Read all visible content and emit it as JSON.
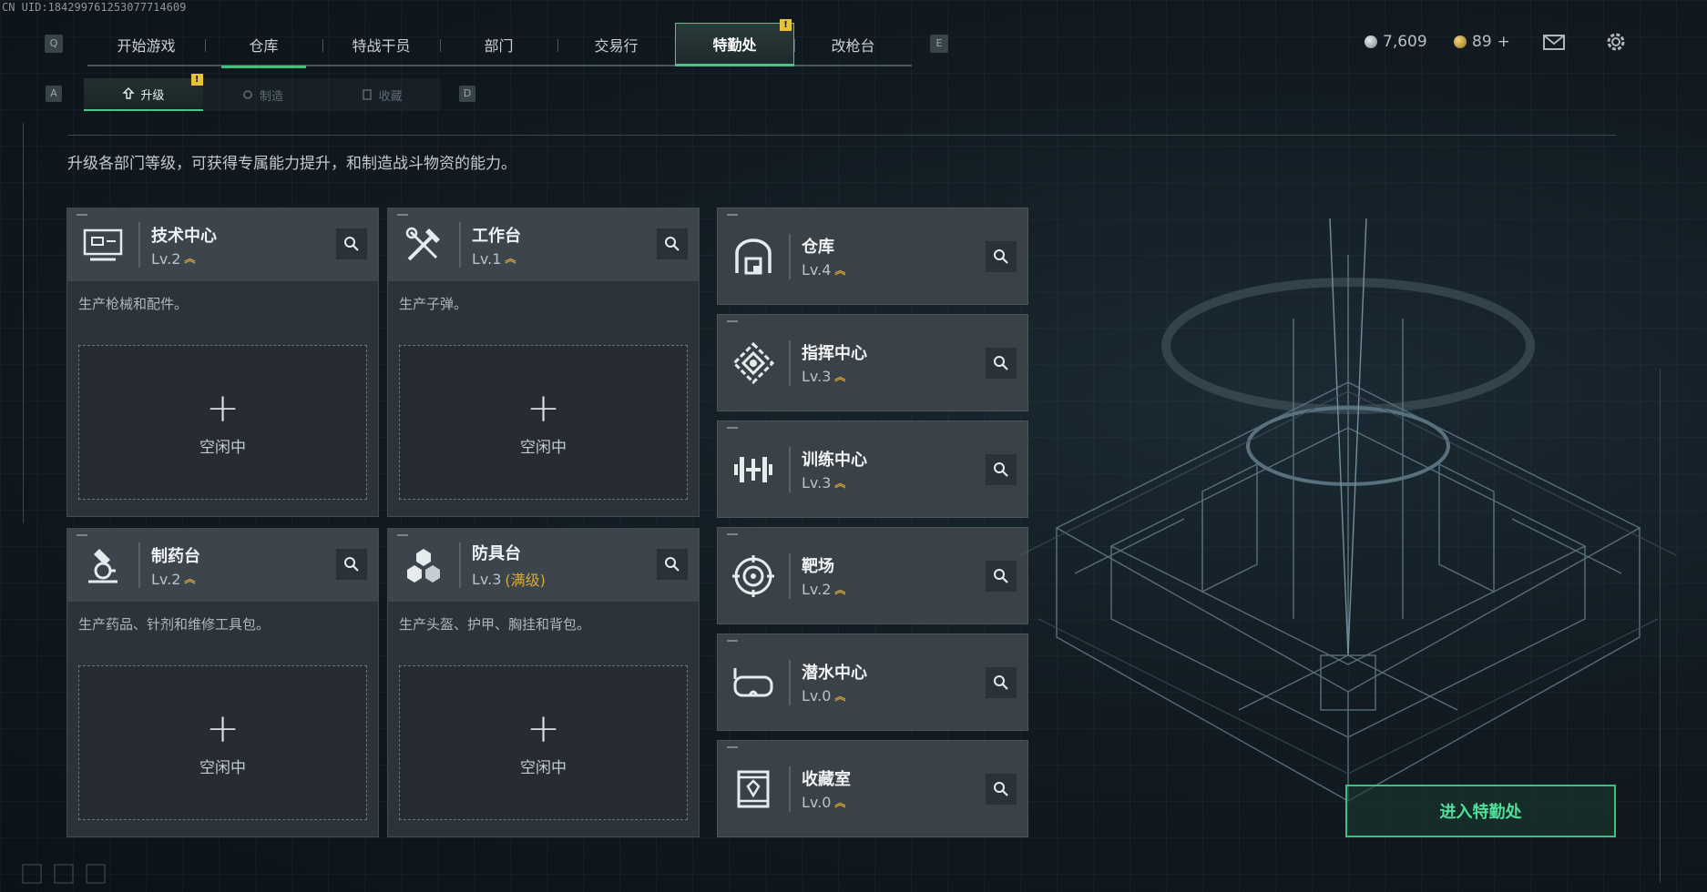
{
  "uid": "CN UID:18429976125307771460​9",
  "topnav": {
    "q_key": "Q",
    "e_key": "E",
    "tabs": [
      {
        "label": "开始游戏"
      },
      {
        "label": "仓库"
      },
      {
        "label": "特战干员"
      },
      {
        "label": "部门"
      },
      {
        "label": "交易行"
      },
      {
        "label": "特勤处",
        "selected": true,
        "alert": "!"
      },
      {
        "label": "改枪台"
      }
    ]
  },
  "currency": {
    "silver": "7,609",
    "gold": "89",
    "gold_plus": "+"
  },
  "subnav": {
    "a_key": "A",
    "d_key": "D",
    "tabs": [
      {
        "label": "升级",
        "selected": true,
        "alert": "!"
      },
      {
        "label": "制造"
      },
      {
        "label": "收藏"
      }
    ]
  },
  "description": "升级各部门等级，可获得专属能力提升，和制造战斗物资的能力。",
  "production_cards": [
    {
      "name": "技术中心",
      "level": "Lv.2",
      "desc": "生产枪械和配件。",
      "slot_status": "空闲中"
    },
    {
      "name": "工作台",
      "level": "Lv.1",
      "desc": "生产子弹。",
      "slot_status": "空闲中"
    },
    {
      "name": "制药台",
      "level": "Lv.2",
      "desc": "生产药品、针剂和维修工具包。",
      "slot_status": "空闲中"
    },
    {
      "name": "防具台",
      "level": "Lv.3",
      "maxed": "(满级)",
      "desc": "生产头盔、护甲、胸挂和背包。",
      "slot_status": "空闲中"
    }
  ],
  "facility_cards": [
    {
      "name": "仓库",
      "level": "Lv.4"
    },
    {
      "name": "指挥中心",
      "level": "Lv.3"
    },
    {
      "name": "训练中心",
      "level": "Lv.3"
    },
    {
      "name": "靶场",
      "level": "Lv.2"
    },
    {
      "name": "潜水中心",
      "level": "Lv.0"
    },
    {
      "name": "收藏室",
      "level": "Lv.0"
    }
  ],
  "enter_button": "进入特勤处",
  "colors": {
    "accent_green": "#4ec48a",
    "alert_yellow": "#e8c23a",
    "maxed_gold": "#d9a93b"
  }
}
